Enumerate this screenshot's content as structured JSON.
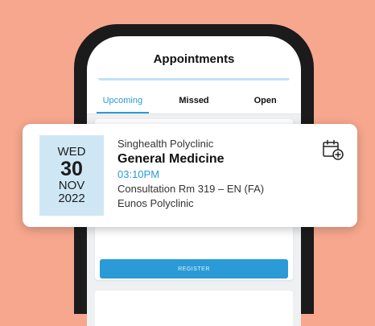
{
  "header": {
    "title": "Appointments"
  },
  "tabs": [
    {
      "label": "Upcoming",
      "active": true
    },
    {
      "label": "Missed",
      "active": false
    },
    {
      "label": "Open",
      "active": false
    }
  ],
  "appointment": {
    "day_of_week": "WED",
    "day": "30",
    "month": "NOV",
    "year": "2022",
    "clinic": "Singhealth Polyclinic",
    "service": "General Medicine",
    "time": "03:10PM",
    "room": "Consultation Rm 319 – EN (FA)",
    "location": "Eunos Polyclinic",
    "add_calendar_icon": "calendar-add-icon"
  },
  "actions": {
    "register_label": "REGISTER"
  },
  "colors": {
    "background": "#f6a78d",
    "accent": "#2a9bd6",
    "date_box": "#cfe7f5"
  }
}
